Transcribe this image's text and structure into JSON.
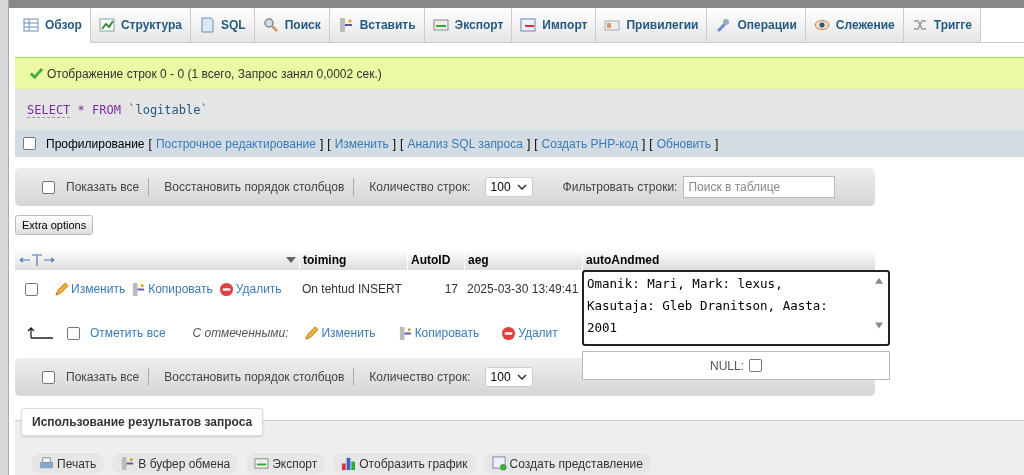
{
  "tabs": [
    {
      "kind": "browse",
      "label": "Обзор",
      "selected": true
    },
    {
      "kind": "structure",
      "label": "Структура",
      "selected": false
    },
    {
      "kind": "sql",
      "label": "SQL",
      "selected": false
    },
    {
      "kind": "search",
      "label": "Поиск",
      "selected": false
    },
    {
      "kind": "insert",
      "label": "Вставить",
      "selected": false
    },
    {
      "kind": "export",
      "label": "Экспорт",
      "selected": false
    },
    {
      "kind": "import",
      "label": "Импорт",
      "selected": false
    },
    {
      "kind": "privileges",
      "label": "Привилегии",
      "selected": false
    },
    {
      "kind": "operations",
      "label": "Операции",
      "selected": false
    },
    {
      "kind": "tracking",
      "label": "Слежение",
      "selected": false
    },
    {
      "kind": "triggers",
      "label": "Тригге",
      "selected": false
    }
  ],
  "notice": "Отображение строк 0 - 0 (1 всего, Запрос занял 0,0002 сек.)",
  "query": {
    "select": "SELECT",
    "star": "*",
    "from": "FROM",
    "table": "`logitable`"
  },
  "profiling": {
    "label": "Профилирование",
    "checked": false,
    "open": "[",
    "close": "]",
    "links": [
      "Построчное редактирование",
      "Изменить",
      "Анализ SQL запроса",
      "Создать PHP-код",
      "Обновить"
    ]
  },
  "toolbars": [
    {
      "show_all": "Показать все",
      "show_all_checked": false,
      "restore": "Восстановить порядок столбцов",
      "rows_label": "Количество строк:",
      "rows_value": "100",
      "filter_label": "Фильтровать строки:",
      "filter_placeholder": "Поиск в таблице"
    },
    {
      "show_all": "Показать все",
      "show_all_checked": false,
      "restore": "Восстановить порядок столбцов",
      "rows_label": "Количество строк:",
      "rows_value": "100"
    }
  ],
  "extra_options": "Extra options",
  "table": {
    "columns": [
      "toiming",
      "AutoID",
      "aeg",
      "autoAndmed"
    ],
    "rows": [
      {
        "checked": false,
        "actions": [
          {
            "kind": "edit",
            "label": "Изменить"
          },
          {
            "kind": "copy",
            "label": "Копировать"
          },
          {
            "kind": "delete",
            "label": "Удалить"
          }
        ],
        "cells": [
          "On tehtud INSERT",
          "17",
          "2025-03-30 13:49:41"
        ]
      }
    ]
  },
  "inline_edit": {
    "value": "Omanik: Mari, Mark: lexus, Kasutaja: Gleb Dranitson, Aasta: 2001",
    "null_label": "NULL:",
    "null_checked": false
  },
  "bulk": {
    "check_all": "Отметить все",
    "checked": false,
    "with_selected": "С отмеченными:",
    "actions": [
      {
        "kind": "edit",
        "label": "Изменить"
      },
      {
        "kind": "copy",
        "label": "Копировать"
      },
      {
        "kind": "delete",
        "label": "Удалит"
      }
    ]
  },
  "query_results": {
    "title": "Использование результатов запроса",
    "actions": [
      {
        "kind": "print",
        "label": "Печать"
      },
      {
        "kind": "copy",
        "label": "В буфер обмена"
      },
      {
        "kind": "export",
        "label": "Экспорт"
      },
      {
        "kind": "chart",
        "label": "Отобразить график"
      },
      {
        "kind": "view",
        "label": "Создать представление"
      }
    ]
  }
}
